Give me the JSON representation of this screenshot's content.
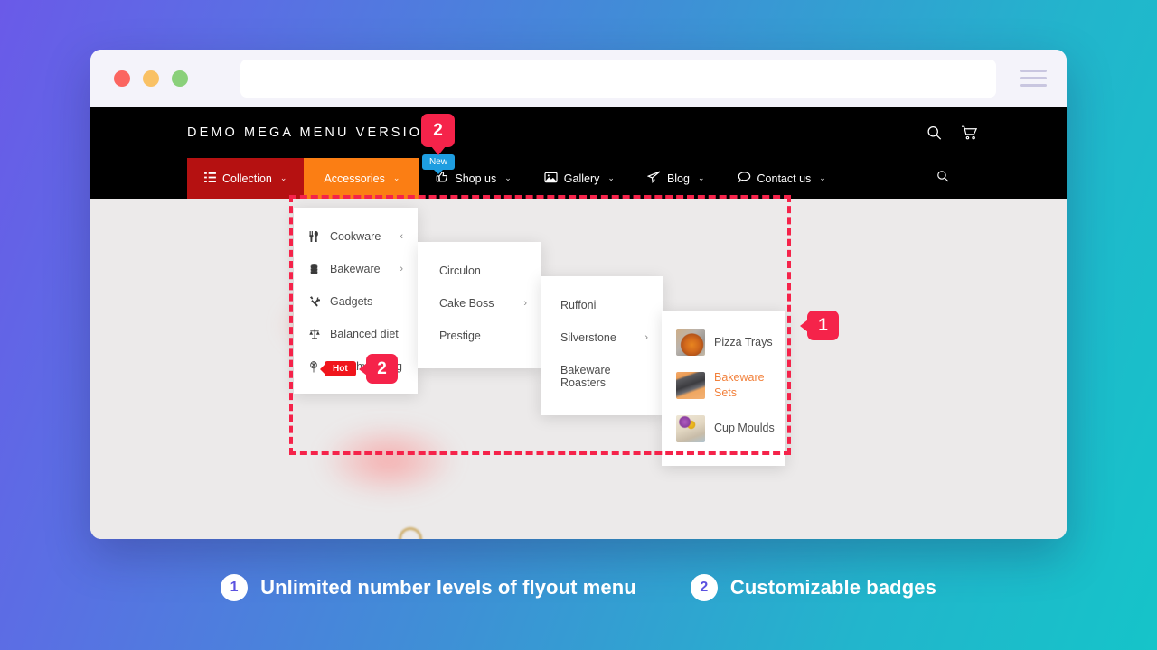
{
  "theme": {
    "page_gradient_start": "#6a5ae8",
    "page_gradient_end": "#15c4c9",
    "accent_red": "#f5234a",
    "nav_collection_bg": "#b51111",
    "nav_accessories_bg": "#fb7e14",
    "badge_new_bg": "#1e9de0",
    "badge_hot_bg": "#f0151c",
    "active_product_color": "#f2813c"
  },
  "browser": {
    "url_value": "",
    "url_placeholder": "",
    "traffic_lights": [
      "close",
      "minimize",
      "maximize"
    ],
    "menu_icon": "hamburger-icon"
  },
  "site": {
    "title": "DEMO MEGA MENU VERSION 2",
    "header_icons": [
      {
        "name": "search-icon"
      },
      {
        "name": "cart-icon"
      }
    ],
    "nav": [
      {
        "label": "Collection",
        "icon": "list-icon",
        "caret": "⌄",
        "state": "active-red"
      },
      {
        "label": "Accessories",
        "icon": "",
        "caret": "⌄",
        "state": "active-orange"
      },
      {
        "label": "Shop us",
        "icon": "thumbs-up-icon",
        "caret": "⌄",
        "state": "default"
      },
      {
        "label": "Gallery",
        "icon": "image-icon",
        "caret": "⌄",
        "state": "default"
      },
      {
        "label": "Blog",
        "icon": "paper-plane-icon",
        "caret": "⌄",
        "state": "default"
      },
      {
        "label": "Contact us",
        "icon": "chat-bubble-icon",
        "caret": "⌄",
        "state": "default"
      }
    ],
    "nav_search_icon": "search-icon"
  },
  "menus": {
    "level1": [
      {
        "label": "Cookware",
        "icon": "cutlery-icon",
        "arrow": "‹"
      },
      {
        "label": "Bakeware",
        "icon": "layers-icon",
        "arrow": "›"
      },
      {
        "label": "Gadgets",
        "icon": "tools-icon",
        "arrow": ""
      },
      {
        "label": "Balanced diet",
        "icon": "scales-icon",
        "arrow": ""
      },
      {
        "label": "Healthy eating",
        "icon": "whisk-icon",
        "arrow": "",
        "badge": "Hot"
      }
    ],
    "level2": [
      {
        "label": "Circulon",
        "arrow": ""
      },
      {
        "label": "Cake Boss",
        "arrow": "›"
      },
      {
        "label": "Prestige",
        "arrow": ""
      }
    ],
    "level3": [
      {
        "label": "Ruffoni",
        "arrow": ""
      },
      {
        "label": "Silverstone",
        "arrow": "›"
      },
      {
        "label": "Bakeware Roasters",
        "arrow": ""
      }
    ],
    "level4": [
      {
        "label": "Pizza Trays",
        "thumb": "pizza-tray-thumbnail",
        "active": false
      },
      {
        "label": "Bakeware Sets",
        "thumb": "bakeware-set-thumbnail",
        "active": true
      },
      {
        "label": "Cup Moulds",
        "thumb": "cup-mould-thumbnail",
        "active": false
      }
    ]
  },
  "badges": {
    "new": "New",
    "hot": "Hot"
  },
  "callouts": {
    "one": "1",
    "two_top": "2",
    "two_menu": "2"
  },
  "footer": {
    "captions": [
      {
        "number": "1",
        "text": "Unlimited number levels of flyout menu"
      },
      {
        "number": "2",
        "text": "Customizable badges"
      }
    ]
  }
}
